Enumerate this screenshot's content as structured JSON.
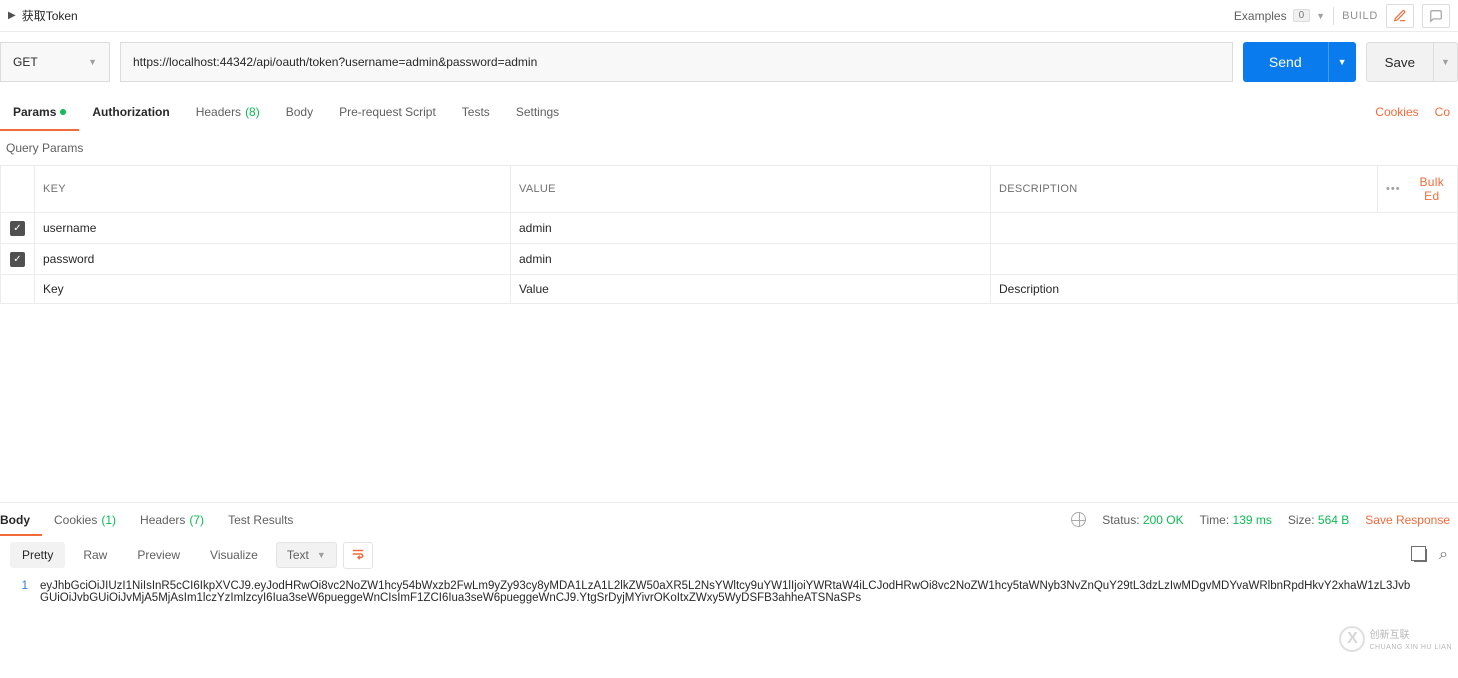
{
  "header": {
    "title": "获取Token",
    "examples_label": "Examples",
    "examples_count": "0",
    "build": "BUILD"
  },
  "request": {
    "method": "GET",
    "url": "https://localhost:44342/api/oauth/token?username=admin&password=admin",
    "send": "Send",
    "save": "Save"
  },
  "req_tabs": {
    "params": "Params",
    "authorization": "Authorization",
    "headers": "Headers",
    "headers_count": "(8)",
    "body": "Body",
    "prerequest": "Pre-request Script",
    "tests": "Tests",
    "settings": "Settings",
    "cookies": "Cookies",
    "code": "Co"
  },
  "query": {
    "section": "Query Params",
    "th_key": "KEY",
    "th_value": "VALUE",
    "th_desc": "DESCRIPTION",
    "bulk": "Bulk Ed",
    "rows": [
      {
        "key": "username",
        "value": "admin",
        "desc": ""
      },
      {
        "key": "password",
        "value": "admin",
        "desc": ""
      }
    ],
    "ph_key": "Key",
    "ph_value": "Value",
    "ph_desc": "Description"
  },
  "resp_tabs": {
    "body": "Body",
    "cookies": "Cookies",
    "cookies_count": "(1)",
    "headers": "Headers",
    "headers_count": "(7)",
    "tests": "Test Results"
  },
  "status": {
    "status_label": "Status:",
    "status_val": "200 OK",
    "time_label": "Time:",
    "time_val": "139 ms",
    "size_label": "Size:",
    "size_val": "564 B",
    "save_resp": "Save Response"
  },
  "resp_toolbar": {
    "pretty": "Pretty",
    "raw": "Raw",
    "preview": "Preview",
    "visualize": "Visualize",
    "type": "Text"
  },
  "resp_body": {
    "ln": "1",
    "text": "eyJhbGciOiJIUzI1NiIsInR5cCI6IkpXVCJ9.eyJodHRwOi8vc2NoZW1hcy54bWxzb2FwLm9yZy93cy8yMDA1LzA1L2lkZW50aXR5L2NsYWltcy9uYW1lIjoiYWRtaW4iLCJodHRwOi8vc2NoZW1hcy5taWNyb3NvZnQuY29tL3dzLzIwMDgvMDYvaWRlbnRpdHkvY2xhaW1zL3JvbGUiOiJvbGUiOiJvMjA5MjAsIm1lczYzImlzcyI6Iua3seW6pueggeWnCIsImF1ZCI6Iua3seW6pueggeWnCJ9.YtgSrDyjMYivrOKoItxZWxy5WyDSFB3ahheATSNaSPs"
  }
}
